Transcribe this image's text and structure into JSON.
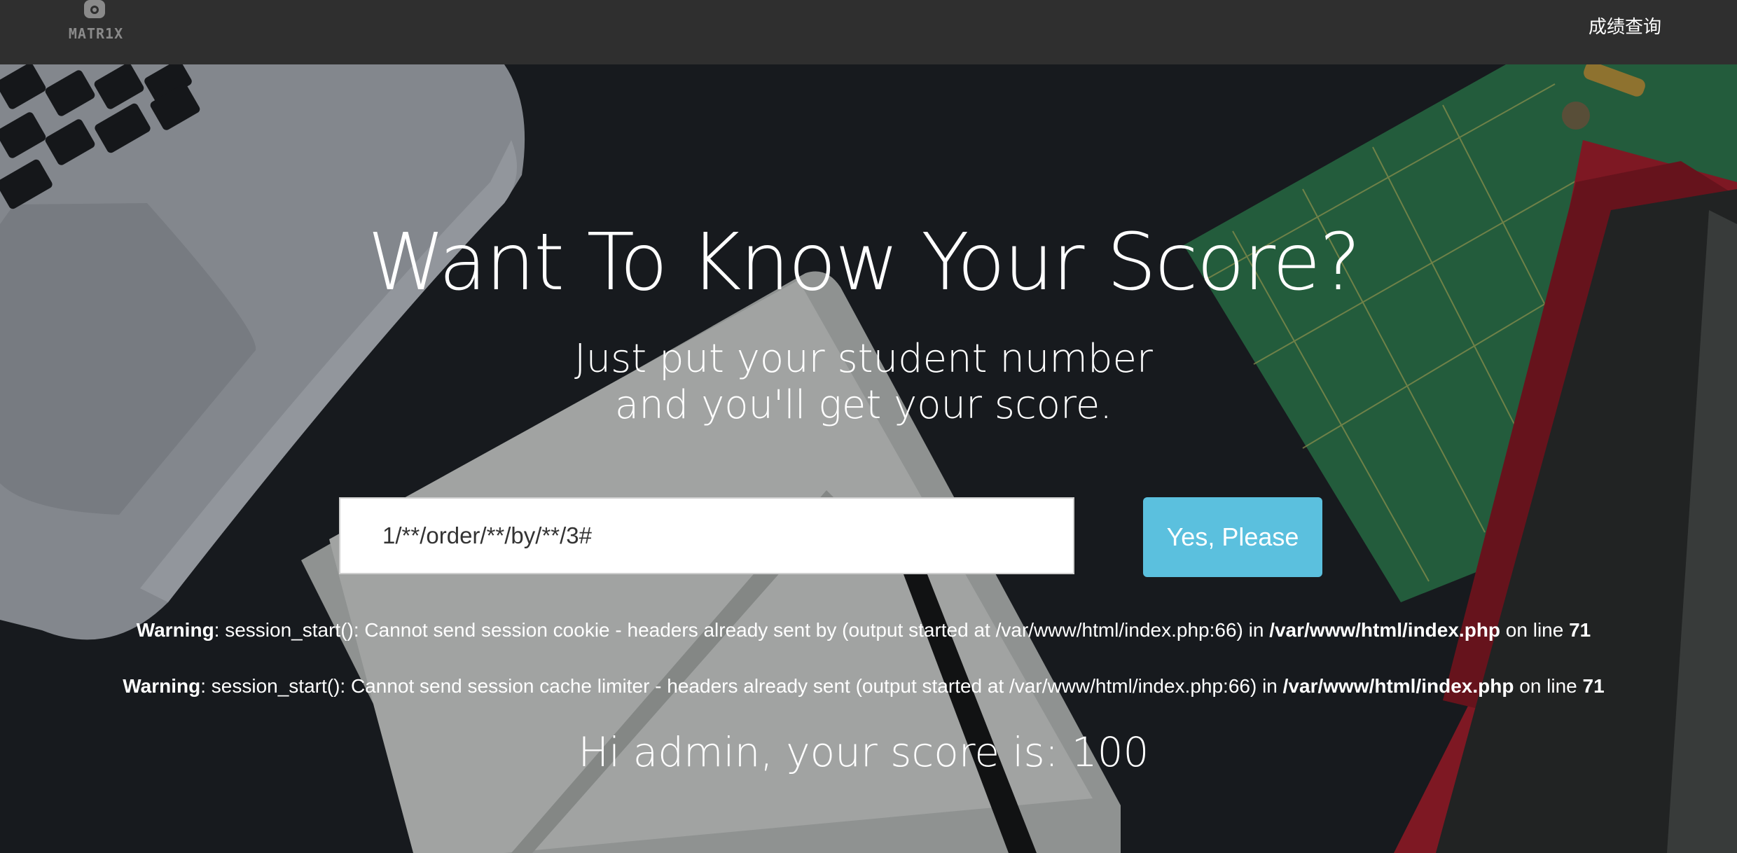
{
  "navbar": {
    "logo_text": "MATR1X",
    "link_label": "成绩查询"
  },
  "hero": {
    "title": "Want To Know Your Score?",
    "subtitle_line1": "Just put your student number",
    "subtitle_line2": "and you'll get your score."
  },
  "form": {
    "input_value": "1/**/order/**/by/**/3#",
    "button_label": "Yes, Please"
  },
  "warnings": [
    {
      "label": "Warning",
      "message": ": session_start(): Cannot send session cookie - headers already sent by (output started at /var/www/html/index.php:66) in ",
      "file": "/var/www/html/index.php",
      "on_line": " on line ",
      "line": "71"
    },
    {
      "label": "Warning",
      "message": ": session_start(): Cannot send session cache limiter - headers already sent (output started at /var/www/html/index.php:66) in ",
      "file": "/var/www/html/index.php",
      "on_line": " on line ",
      "line": "71"
    }
  ],
  "result": {
    "text": "Hi admin, your score is: 100"
  },
  "colors": {
    "navbar_bg": "#2f2f2f",
    "button_bg": "#5bc0de",
    "desk_bg": "#1d2024"
  },
  "icons": {
    "logo": "robot-logo-icon"
  }
}
